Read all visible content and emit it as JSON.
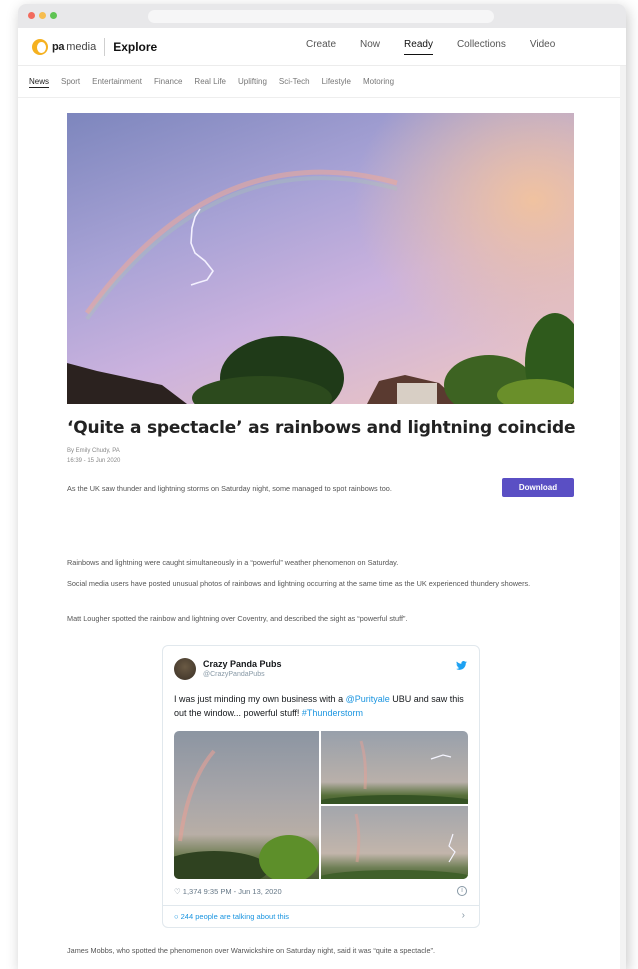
{
  "browser": {},
  "header": {
    "logo_pa": "pa",
    "logo_media": "media",
    "app_name": "Explore",
    "nav": [
      "Create",
      "Now",
      "Ready",
      "Collections",
      "Video"
    ],
    "active_nav": "Ready"
  },
  "subnav": {
    "items": [
      "News",
      "Sport",
      "Entertainment",
      "Finance",
      "Real Life",
      "Uplifting",
      "Sci-Tech",
      "Lifestyle",
      "Motoring"
    ],
    "active": "News"
  },
  "article": {
    "headline": "‘Quite a spectacle’ as rainbows and lightning coincide",
    "author": "By Emily Chudy, PA",
    "datetime": "16:39 - 15 Jun 2020",
    "summary": "As the UK saw thunder and lightning storms on Saturday night, some managed to spot rainbows too.",
    "download_label": "Download",
    "paragraphs": [
      "Rainbows and lightning were caught simultaneously in a “powerful” weather phenomenon on Saturday.",
      "Social media users have posted unusual photos of rainbows and lightning occurring at the same time as the UK experienced thundery showers.",
      "Matt Lougher spotted the rainbow and lightning over Coventry, and described the sight as “powerful stuff”.",
      "James Mobbs, who spotted the phenomenon over Warwickshire on Saturday night, said it was “quite a spectacle”."
    ]
  },
  "tweet": {
    "name": "Crazy Panda Pubs",
    "handle": "@CrazyPandaPubs",
    "text_before": "I was just minding my own business with a ",
    "mention": "@Purityale",
    "text_middle": " UBU and saw this out the window... powerful stuff! ",
    "hashtag": "#Thunderstorm",
    "likes_and_time": "♡ 1,374   9:35 PM - Jun 13, 2020",
    "info_icon": "i",
    "talking": "244 people are talking about this",
    "chevron": "›"
  },
  "colors": {
    "accent": "#5a4fc4",
    "twitter_blue": "#1b95e0",
    "logo_yellow": "#f5b120"
  }
}
